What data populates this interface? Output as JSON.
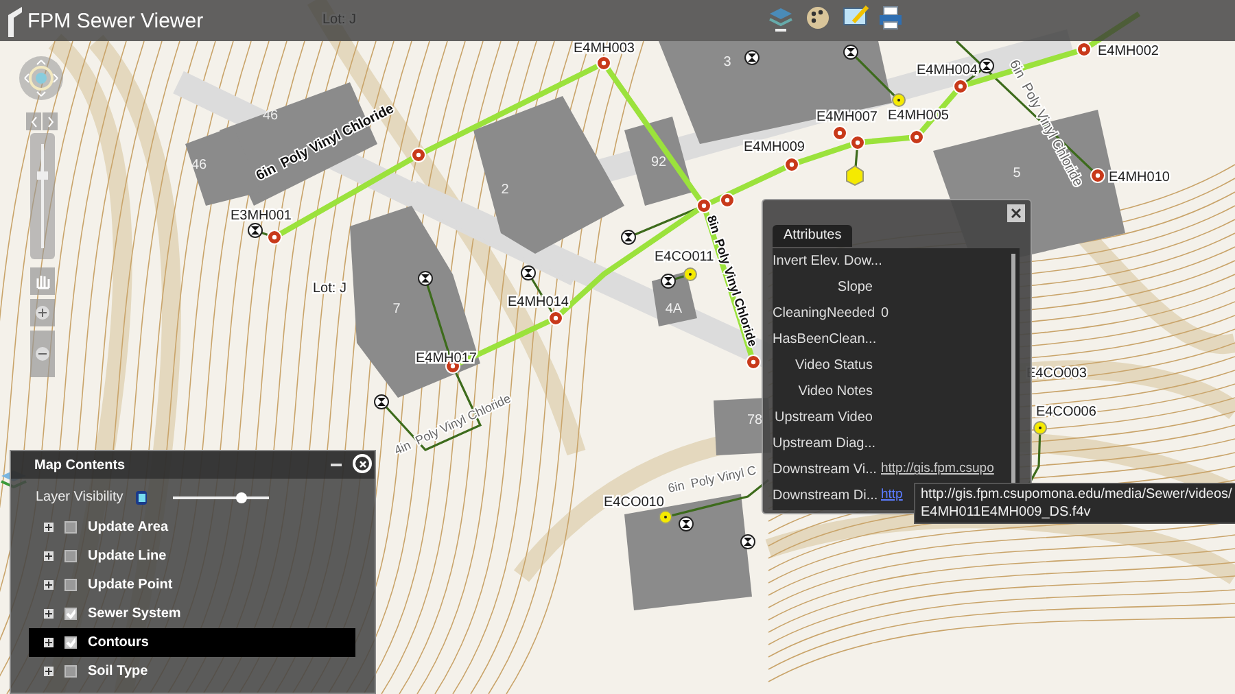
{
  "app": {
    "title": "FPM Sewer Viewer"
  },
  "zoom_slider": {
    "level": 0.7
  },
  "map": {
    "buildings": [
      {
        "label": "46"
      },
      {
        "label": "46"
      },
      {
        "label": "2"
      },
      {
        "label": "92"
      },
      {
        "label": "3"
      },
      {
        "label": "5"
      },
      {
        "label": "7"
      },
      {
        "label": "4A"
      },
      {
        "label": "78"
      }
    ],
    "lots": [
      {
        "label": "Lot: J"
      },
      {
        "label": "Lot: J"
      }
    ],
    "stations": [
      {
        "label": "E3MH001"
      },
      {
        "label": "E4MH003"
      },
      {
        "label": "E4MH004"
      },
      {
        "label": "E4MH005"
      },
      {
        "label": "E4MH007"
      },
      {
        "label": "E4MH009"
      },
      {
        "label": "E4MH002"
      },
      {
        "label": "E4MH010"
      },
      {
        "label": "E4MH014"
      },
      {
        "label": "E4MH017"
      },
      {
        "label": "E4CO011"
      },
      {
        "label": "E4CO003"
      },
      {
        "label": "E4CO006"
      },
      {
        "label": "E4CO010"
      }
    ],
    "pipes": [
      {
        "label": "6in  Poly Vinyl Chloride",
        "kind": "main"
      },
      {
        "label": "8in  Poly Vinyl Chloride",
        "kind": "main"
      },
      {
        "label": "6in  Poly Vinyl Chloride",
        "kind": "lateral"
      },
      {
        "label": "4in  Poly Vinyl Chloride",
        "kind": "lateral"
      },
      {
        "label": "6in  Poly Vinyl C",
        "kind": "lateral"
      }
    ]
  },
  "attributes": {
    "tab": "Attributes",
    "rows": [
      {
        "field": "Invert Elev. Dow..."
      },
      {
        "field": "Slope"
      },
      {
        "field": "CleaningNeeded",
        "value": "0",
        "kind": "text"
      },
      {
        "field": "HasBeenClean..."
      },
      {
        "field": "Video Status"
      },
      {
        "field": "Video Notes"
      },
      {
        "field": "Upstream Video"
      },
      {
        "field": "Upstream Diag..."
      },
      {
        "field": "Downstream Vi...",
        "value": "http://gis.fpm.csupo",
        "kind": "link",
        "visited": true
      },
      {
        "field": "Downstream Di...",
        "value": "http",
        "kind": "link",
        "visited": false
      }
    ],
    "tooltip": [
      "http://gis.fpm.csupomona.edu/media/Sewer/videos/",
      "E4MH011E4MH009_DS.f4v"
    ]
  },
  "map_contents": {
    "title": "Map Contents",
    "visibility_label": "Layer Visibility",
    "level": 0.72,
    "layers": [
      {
        "name": "Update Area",
        "checked": false,
        "selected": false
      },
      {
        "name": "Update Line",
        "checked": false,
        "selected": false
      },
      {
        "name": "Update Point",
        "checked": false,
        "selected": false
      },
      {
        "name": "Sewer System",
        "checked": true,
        "selected": false
      },
      {
        "name": "Contours",
        "checked": true,
        "selected": true
      },
      {
        "name": "Soil Type",
        "checked": false,
        "selected": false
      }
    ]
  }
}
